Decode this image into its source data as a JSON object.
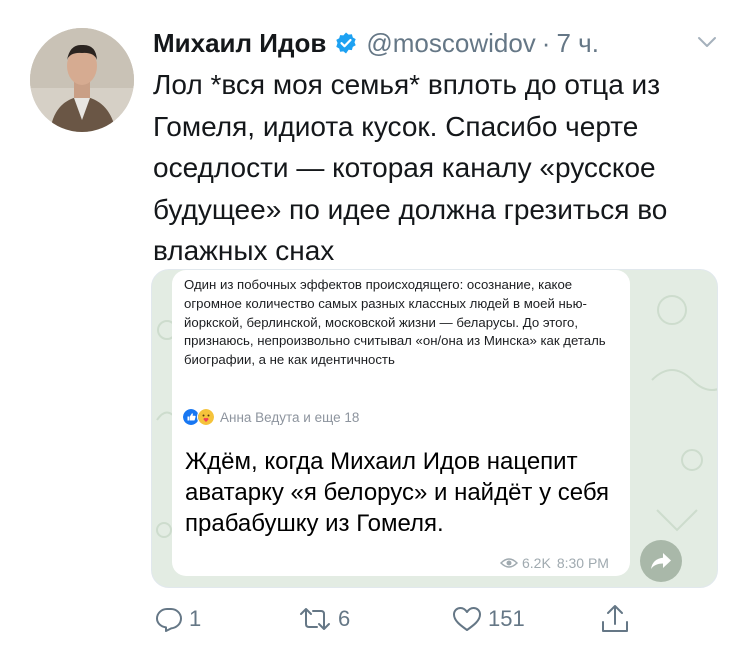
{
  "tweet": {
    "author_name": "Михаил Идов",
    "handle": "@moscowidov",
    "separator": "·",
    "time": "7 ч.",
    "text": "Лол *вся моя семья* вплоть до отца из Гомеля, идиота кусок. Спасибо черте оседлости — которая каналу «русское будущее» по идее должна грезиться во влажных снах"
  },
  "media": {
    "quoted_post": "Один из побочных эффектов происходящего: осознание, какое огромное количество самых разных классных людей в моей нью-йоркской, берлинской, московской жизни — беларусы. До этого, признаюсь, непроизвольно считывал «он/она из Минска» как деталь биографии, а не как идентичность",
    "reactions_label": "Анна Ведута и еще 18",
    "message_text": "Ждём, когда Михаил Идов нацепит аватарку «я белорус» и найдёт у себя прабабушку из Гомеля.",
    "views": "6.2K",
    "message_time": "8:30 PM"
  },
  "actions": {
    "reply_count": "1",
    "retweet_count": "6",
    "like_count": "151"
  },
  "colors": {
    "verified": "#1da1f2",
    "secondary_text": "#657786",
    "media_bg": "#e3ece3"
  },
  "icons": [
    "verified-badge-icon",
    "caret-down-icon",
    "like-reaction-icon",
    "love-reaction-icon",
    "eye-icon",
    "share-arrow-icon",
    "reply-icon",
    "retweet-icon",
    "like-icon",
    "share-icon"
  ]
}
